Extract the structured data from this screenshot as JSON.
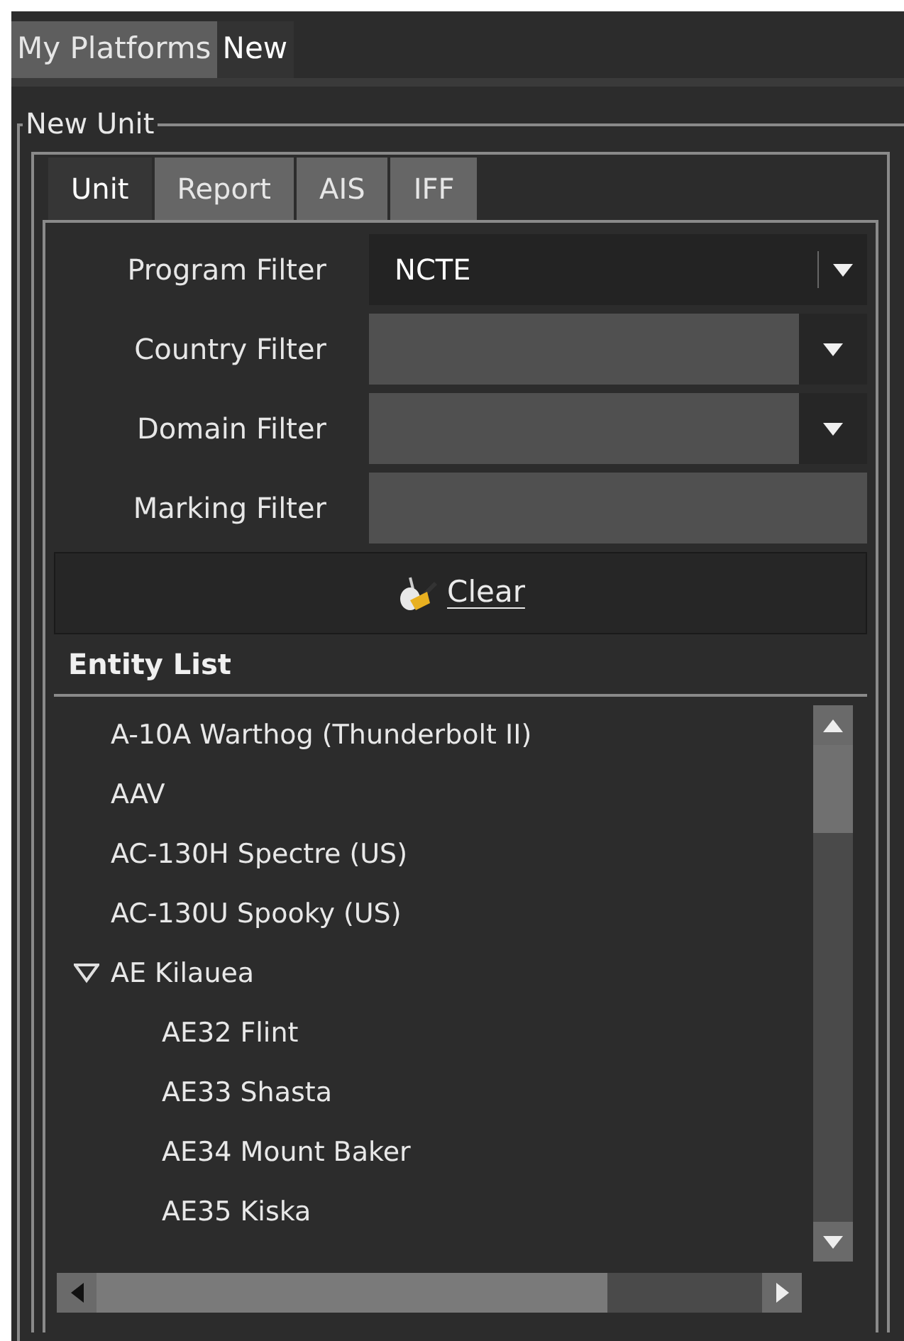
{
  "top_tabs": [
    {
      "label": "My Platforms",
      "selected": false
    },
    {
      "label": "New",
      "selected": true
    }
  ],
  "group": {
    "title": "New Unit"
  },
  "unit_tabs": [
    {
      "label": "Unit",
      "selected": true
    },
    {
      "label": "Report",
      "selected": false
    },
    {
      "label": "AIS",
      "selected": false
    },
    {
      "label": "IFF",
      "selected": false
    }
  ],
  "filters": [
    {
      "label": "Program Filter",
      "kind": "dropdown",
      "value": "NCTE"
    },
    {
      "label": "Country Filter",
      "kind": "dropdown"
    },
    {
      "label": "Domain Filter",
      "kind": "dropdown"
    },
    {
      "label": "Marking Filter",
      "kind": "text"
    }
  ],
  "clear_button": {
    "label": "Clear"
  },
  "entity_list": {
    "title": "Entity List",
    "items": [
      {
        "label": "A-10A Warthog (Thunderbolt II)"
      },
      {
        "label": "AAV"
      },
      {
        "label": "AC-130H Spectre (US)"
      },
      {
        "label": "AC-130U Spooky (US)"
      },
      {
        "label": "AE Kilauea",
        "expanded": true,
        "children": [
          {
            "label": "AE32 Flint"
          },
          {
            "label": "AE33 Shasta"
          },
          {
            "label": "AE34 Mount Baker"
          },
          {
            "label": "AE35 Kiska"
          }
        ]
      }
    ]
  }
}
